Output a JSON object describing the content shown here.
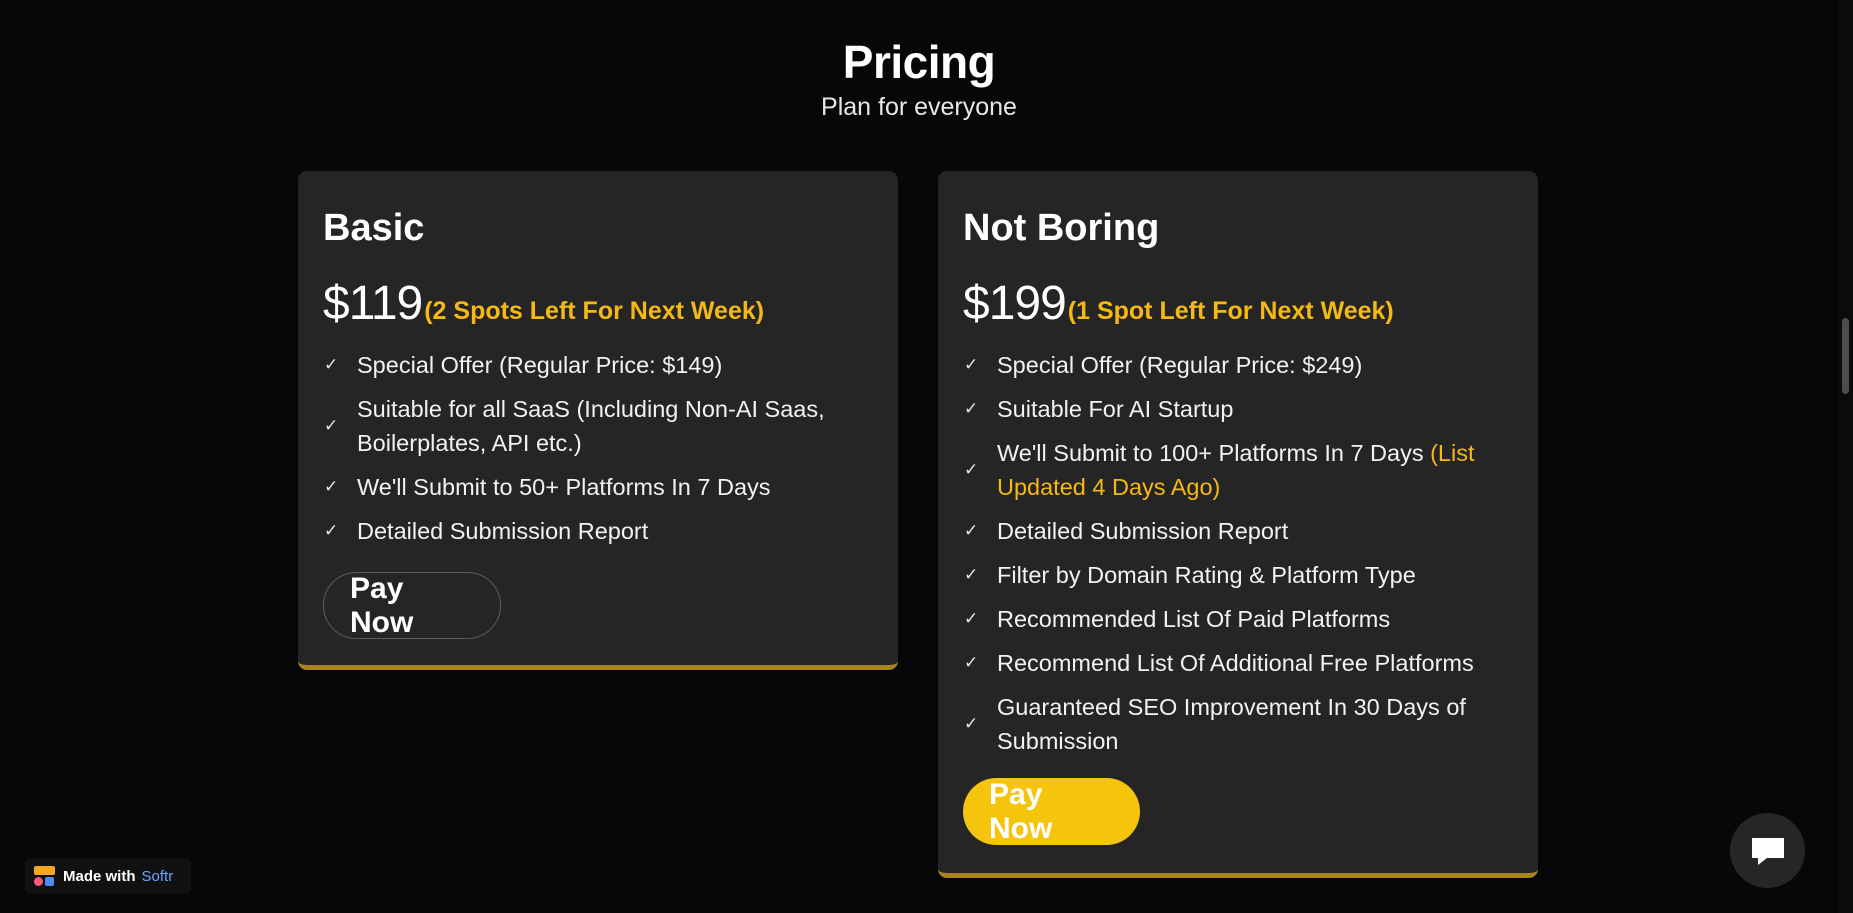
{
  "header": {
    "title": "Pricing",
    "subtitle": "Plan for everyone"
  },
  "plans": [
    {
      "name": "Basic",
      "price": "$119",
      "spots": "(2 Spots Left For Next Week)",
      "features": [
        {
          "text": "Special Offer (Regular Price: $149)",
          "highlight": ""
        },
        {
          "text": "Suitable for all SaaS (Including Non-AI Saas, Boilerplates, API etc.)",
          "highlight": ""
        },
        {
          "text": "We'll Submit to 50+ Platforms In 7 Days",
          "highlight": ""
        },
        {
          "text": "Detailed Submission Report",
          "highlight": ""
        }
      ],
      "cta": "Pay Now"
    },
    {
      "name": "Not Boring",
      "price": "$199",
      "spots": "(1 Spot Left For Next Week)",
      "features": [
        {
          "text": "Special Offer (Regular Price: $249)",
          "highlight": ""
        },
        {
          "text": "Suitable For AI Startup",
          "highlight": ""
        },
        {
          "text": "We'll Submit to 100+ Platforms In 7 Days ",
          "highlight": "(List Updated 4 Days Ago)"
        },
        {
          "text": "Detailed Submission Report",
          "highlight": ""
        },
        {
          "text": "Filter by Domain Rating & Platform Type",
          "highlight": ""
        },
        {
          "text": "Recommended List Of Paid Platforms",
          "highlight": ""
        },
        {
          "text": "Recommend List Of Additional Free Platforms",
          "highlight": ""
        },
        {
          "text": "Guaranteed SEO Improvement In 30 Days of Submission",
          "highlight": ""
        }
      ],
      "cta": "Pay Now"
    }
  ],
  "badge": {
    "made_with": "Made with",
    "brand": "Softr"
  },
  "icons": {
    "feature": "check-icon",
    "chat": "chat-bubble-icon",
    "badge": "softr-logo-icon"
  },
  "colors": {
    "accent": "#f5b914",
    "button_primary": "#f5c50d",
    "card_bg": "#252525",
    "page_bg": "#070707",
    "card_border": "#a8851c",
    "brand_link": "#6aa5ff"
  }
}
